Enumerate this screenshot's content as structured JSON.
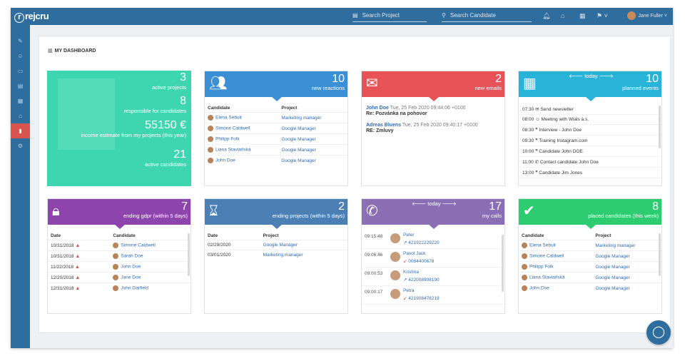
{
  "app": {
    "logo": "rejcru"
  },
  "topbar": {
    "search_project": "Search Project",
    "search_candidate": "Search Candidate",
    "user_name": "Jane Fuller"
  },
  "dashboard_title": "MY DASHBOARD",
  "summary": {
    "active_projects": {
      "value": "3",
      "label": "active projects"
    },
    "responsible": {
      "value": "8",
      "label": "responsible for candidates"
    },
    "income": {
      "value": "55150 €",
      "label": "income estimate from my projects (this year)"
    },
    "active_candidates": {
      "value": "21",
      "label": "active candidates"
    }
  },
  "reactions": {
    "count": "10",
    "label": "new reactions",
    "col_candidate": "Candidate",
    "col_project": "Project",
    "rows": [
      {
        "candidate": "Elena Sebuit",
        "project": "Marketing manager"
      },
      {
        "candidate": "Simone Caldwell",
        "project": "Google Manager"
      },
      {
        "candidate": "Philipp Folk",
        "project": "Google Manager"
      },
      {
        "candidate": "Liana Staviaňská",
        "project": "Google Manager"
      },
      {
        "candidate": "John Doe",
        "project": "Google Manager"
      }
    ]
  },
  "emails": {
    "count": "2",
    "label": "new emails",
    "items": [
      {
        "from": "John Doe",
        "date": "Tue, 25 Feb 2020 09:44:06 +0100",
        "subject": "Re: Pozvánka na pohovor"
      },
      {
        "from": "Adreas Bluens",
        "date": "Tue, 25 Feb 2020 09:40:17 +0100",
        "subject": "RE: Zmluvy"
      }
    ]
  },
  "events": {
    "count": "10",
    "label": "planned events",
    "today": "today",
    "items": [
      {
        "time": "07:30",
        "text": "Send newsletter"
      },
      {
        "time": "08:00",
        "text": "Meeting with Wials a.s."
      },
      {
        "time": "08:30",
        "text": "Interview - John Doe"
      },
      {
        "time": "09:30",
        "text": "Training Instagram.com"
      },
      {
        "time": "10:00",
        "text": "Candidate John DOE"
      },
      {
        "time": "11:00",
        "text": "Contact candidate John Doe"
      },
      {
        "time": "13:00",
        "text": "Candidate Jim Jones"
      }
    ]
  },
  "gdpr": {
    "count": "7",
    "label": "ending gdpr (within 5 days)",
    "col_date": "Date",
    "col_candidate": "Candidate",
    "rows": [
      {
        "date": "10/31/2018",
        "candidate": "Simone Caldwell"
      },
      {
        "date": "10/31/2018",
        "candidate": "Sarah Doe"
      },
      {
        "date": "11/22/2018",
        "candidate": "John Doe"
      },
      {
        "date": "12/20/2018",
        "candidate": "Jane Doe"
      },
      {
        "date": "12/31/2018",
        "candidate": "John Garfield"
      }
    ]
  },
  "ending_projects": {
    "count": "2",
    "label": "ending projects (within 5 days)",
    "col_date": "Date",
    "col_project": "Project",
    "rows": [
      {
        "date": "02/29/2020",
        "project": "Google Manager"
      },
      {
        "date": "03/01/2020",
        "project": "Marketing manager"
      }
    ]
  },
  "calls": {
    "count": "17",
    "label": "my calls",
    "today": "today",
    "items": [
      {
        "time": "09:15:48",
        "name": "Peter",
        "phone": "421922229220"
      },
      {
        "time": "09:06:46",
        "name": "Pavol Jack",
        "phone": "0084400678"
      },
      {
        "time": "09:00:53",
        "name": "Kristína",
        "phone": "422008908190"
      },
      {
        "time": "09:00:17",
        "name": "Petra",
        "phone": "421908478219"
      }
    ]
  },
  "placed": {
    "count": "8",
    "label": "placed candidates (this week)",
    "col_candidate": "Candidate",
    "col_project": "Project",
    "rows": [
      {
        "candidate": "Elena Sebuit",
        "project": "Marketing manager"
      },
      {
        "candidate": "Simone Caldwell",
        "project": "Google Manager"
      },
      {
        "candidate": "Philipp Folk",
        "project": "Google Manager"
      },
      {
        "candidate": "Liana Staviaňská",
        "project": "Google Manager"
      },
      {
        "candidate": "John Doe",
        "project": "Google Manager"
      }
    ]
  },
  "colors": {
    "topbar": "#2f6d9e",
    "teal": "#3dd6b0",
    "blue": "#3b8fd4",
    "red": "#e8535a",
    "cyan": "#2ab3d9",
    "purple": "#8e44ad",
    "steel": "#4c7fb3",
    "lavender": "#8a6fb5",
    "green": "#2ecc71"
  }
}
